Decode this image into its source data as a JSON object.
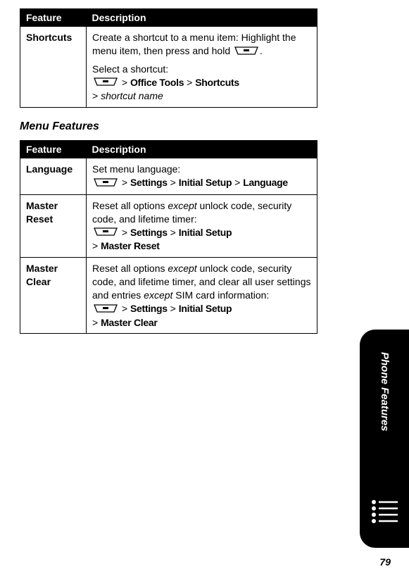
{
  "table1": {
    "headers": {
      "feature": "Feature",
      "description": "Description"
    },
    "row": {
      "feature": "Shortcuts",
      "desc1_line1": "Create a shortcut to a menu item:",
      "desc1_line2a": "Highlight the menu item, then press and hold ",
      "desc1_line2b": ".",
      "desc2_line1": "Select a shortcut:",
      "path_sep": " > ",
      "path_a": "Office Tools",
      "path_b": "Shortcuts",
      "desc2_tail": "shortcut name"
    }
  },
  "section_heading": "Menu Features",
  "table2": {
    "headers": {
      "feature": "Feature",
      "description": "Description"
    },
    "rows": [
      {
        "feature": "Language",
        "lead": "Set menu language:",
        "path": [
          "Settings",
          "Initial Setup",
          "Language"
        ]
      },
      {
        "feature": "Master Reset",
        "lead_a": "Reset all options ",
        "lead_em": "except",
        "lead_b": " unlock code, security code, and lifetime timer:",
        "path": [
          "Settings",
          "Initial Setup"
        ],
        "tail": "Master Reset"
      },
      {
        "feature": "Master Clear",
        "lead_a": "Reset all options ",
        "lead_em1": "except",
        "lead_b": " unlock code, security code, and lifetime timer, and clear all user settings and entries ",
        "lead_em2": "except",
        "lead_c": " SIM card information:",
        "path": [
          "Settings",
          "Initial Setup"
        ],
        "tail": "Master Clear"
      }
    ]
  },
  "sep": " > ",
  "side_tab": "Phone Features",
  "page_number": "79"
}
